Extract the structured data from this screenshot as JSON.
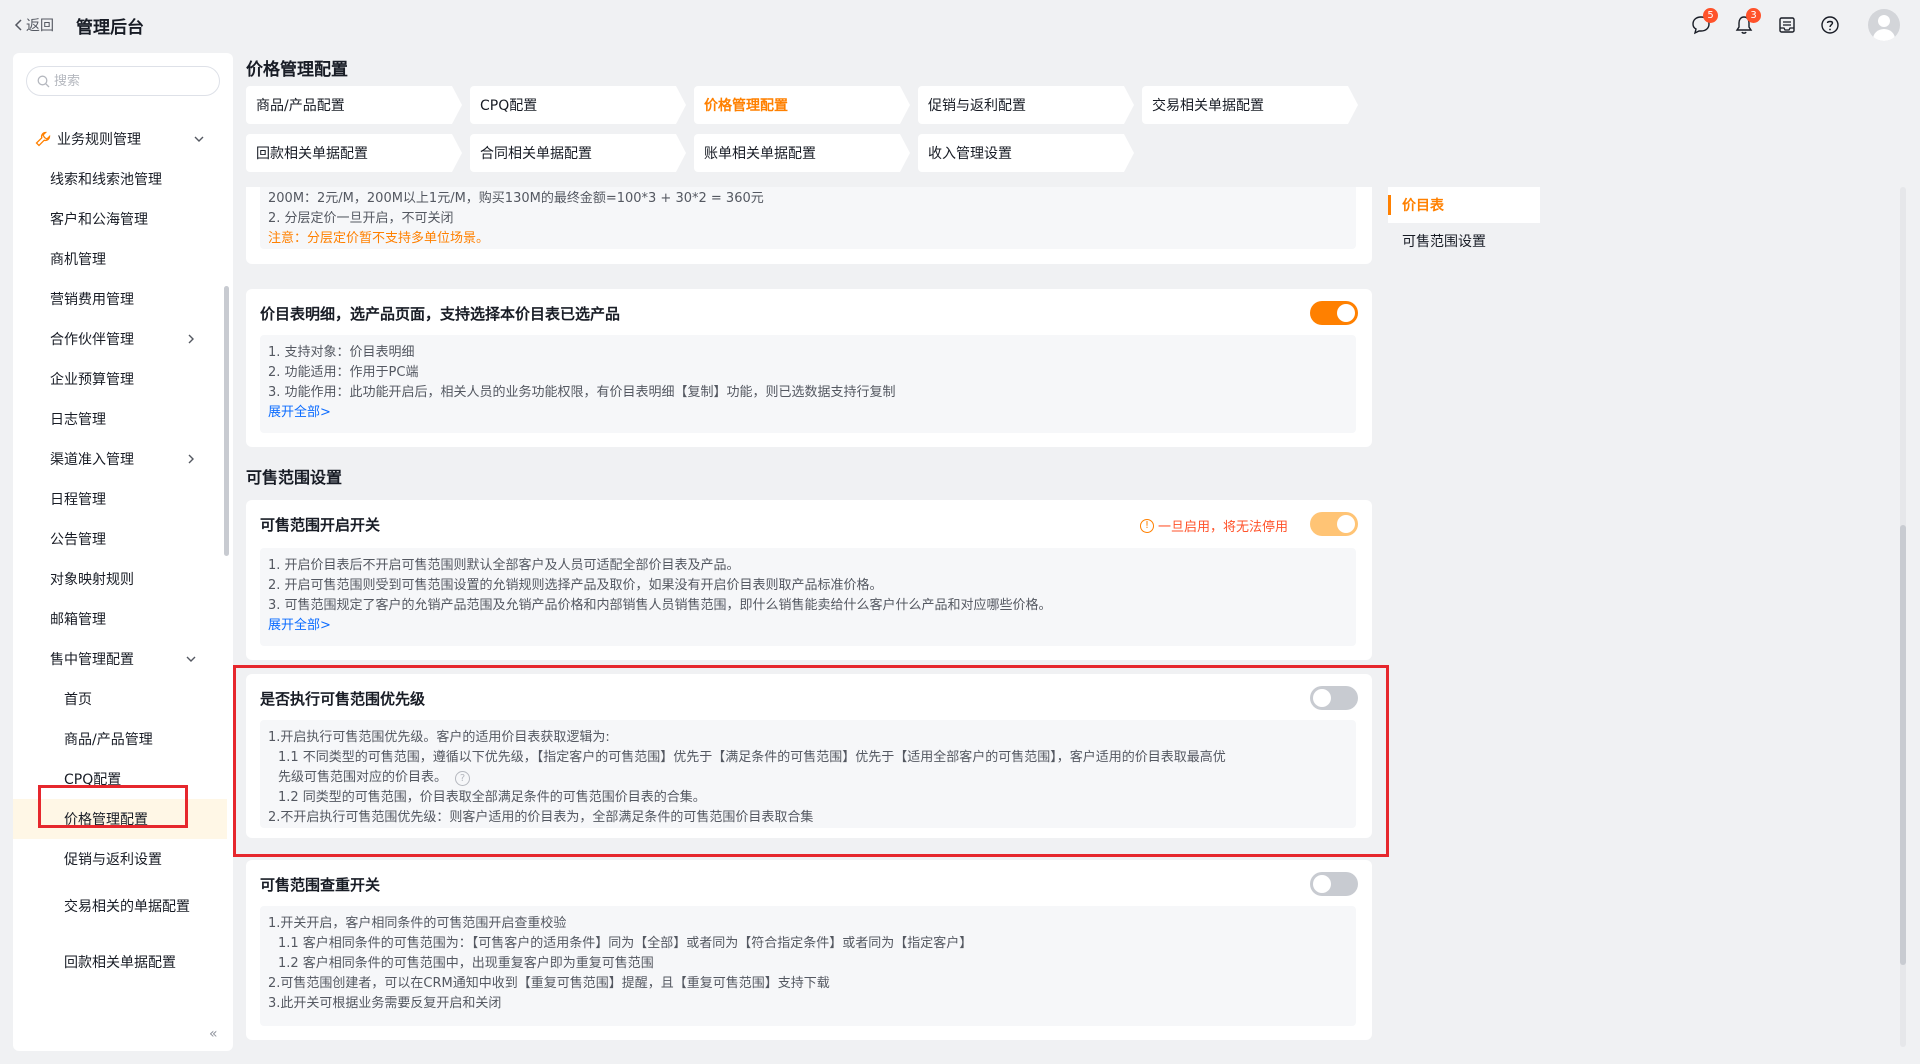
{
  "topbar": {
    "back_label": "返回",
    "title": "管理后台",
    "icons": [
      {
        "name": "message-icon",
        "badge": "5"
      },
      {
        "name": "bell-icon",
        "badge": "3"
      },
      {
        "name": "inbox-icon",
        "badge": ""
      },
      {
        "name": "help-icon",
        "badge": ""
      }
    ]
  },
  "sidebar": {
    "search_placeholder": "搜索",
    "group": "业务规则管理",
    "items": [
      "线索和线索池管理",
      "客户和公海管理",
      "商机管理",
      "营销费用管理",
      "合作伙伴管理",
      "企业预算管理",
      "日志管理",
      "渠道准入管理",
      "日程管理",
      "公告管理",
      "对象映射规则",
      "邮箱管理",
      "售中管理配置"
    ],
    "subitems": [
      "首页",
      "商品/产品管理",
      "CPQ配置",
      "价格管理配置",
      "促销与返利设置",
      "交易相关的单据配置",
      "回款相关单据配置"
    ],
    "collapse_label": "«"
  },
  "page": {
    "title": "价格管理配置",
    "tabs": [
      "商品/产品配置",
      "CPQ配置",
      "价格管理配置",
      "促销与返利配置",
      "交易相关单据配置",
      "回款相关单据配置",
      "合同相关单据配置",
      "账单相关单据配置",
      "收入管理设置"
    ],
    "active_tab": "价格管理配置"
  },
  "cards": {
    "tiered": {
      "line1": "200M：2元/M，200M以上1元/M，购买130M的最终金额=100*3 + 30*2 = 360元",
      "line2": "2. 分层定价一旦开启，不可关闭",
      "note": "注意：分层定价暂不支持多单位场景。"
    },
    "pricebook_detail": {
      "title": "价目表明细，选产品页面，支持选择本价目表已选产品",
      "toggle": "on",
      "lines": [
        "1. 支持对象：价目表明细",
        "2. 功能适用：作用于PC端",
        "3. 功能作用：此功能开启后，相关人员的业务功能权限，有价目表明细【复制】功能，则已选数据支持行复制"
      ],
      "expand": "展开全部>"
    },
    "section_title": "可售范围设置",
    "range_switch": {
      "title": "可售范围开启开关",
      "warning": "一旦启用，将无法停用",
      "toggle": "on",
      "lines": [
        "1. 开启价目表后不开启可售范围则默认全部客户及人员可适配全部价目表及产品。",
        "2. 开启可售范围则受到可售范围设置的允销规则选择产品及取价，如果没有开启价目表则取产品标准价格。",
        "3. 可售范围规定了客户的允销产品范围及允销产品价格和内部销售人员销售范围，即什么销售能卖给什么客户什么产品和对应哪些价格。"
      ],
      "expand": "展开全部>"
    },
    "range_priority": {
      "title": "是否执行可售范围优先级",
      "toggle": "off",
      "line1": "1.开启执行可售范围优先级。客户的适用价目表获取逻辑为:",
      "line2": "1.1 不同类型的可售范围，遵循以下优先级，【指定客户的可售范围】优先于【满足条件的可售范围】优先于【适用全部客户的可售范围】，客户适用的价目表取最高优",
      "line3": "先级可售范围对应的价目表。",
      "line4": "1.2 同类型的可售范围，价目表取全部满足条件的可售范围价目表的合集。",
      "line5": "2.不开启执行可售范围优先级：则客户适用的价目表为，全部满足条件的可售范围价目表取合集"
    },
    "range_dup": {
      "title": "可售范围查重开关",
      "toggle": "off",
      "lines": [
        "1.开关开启，客户相同条件的可售范围开启查重校验",
        "1.1 客户相同条件的可售范围为：【可售客户的适用条件】同为【全部】或者同为【符合指定条件】或者同为【指定客户】",
        "1.2 客户相同条件的可售范围中，出现重复客户即为重复可售范围",
        "2.可售范围创建者，可以在CRM通知中收到【重复可售范围】提醒，且【重复可售范围】支持下载",
        "3.此开关可根据业务需要反复开启和关闭"
      ]
    }
  },
  "anchor_nav": {
    "items": [
      "价目表",
      "可售范围设置"
    ],
    "active": "价目表"
  },
  "colors": {
    "accent": "#ff8000",
    "highlight_border": "#e6272d",
    "link": "#0c6cff",
    "warning": "#ff522a"
  }
}
